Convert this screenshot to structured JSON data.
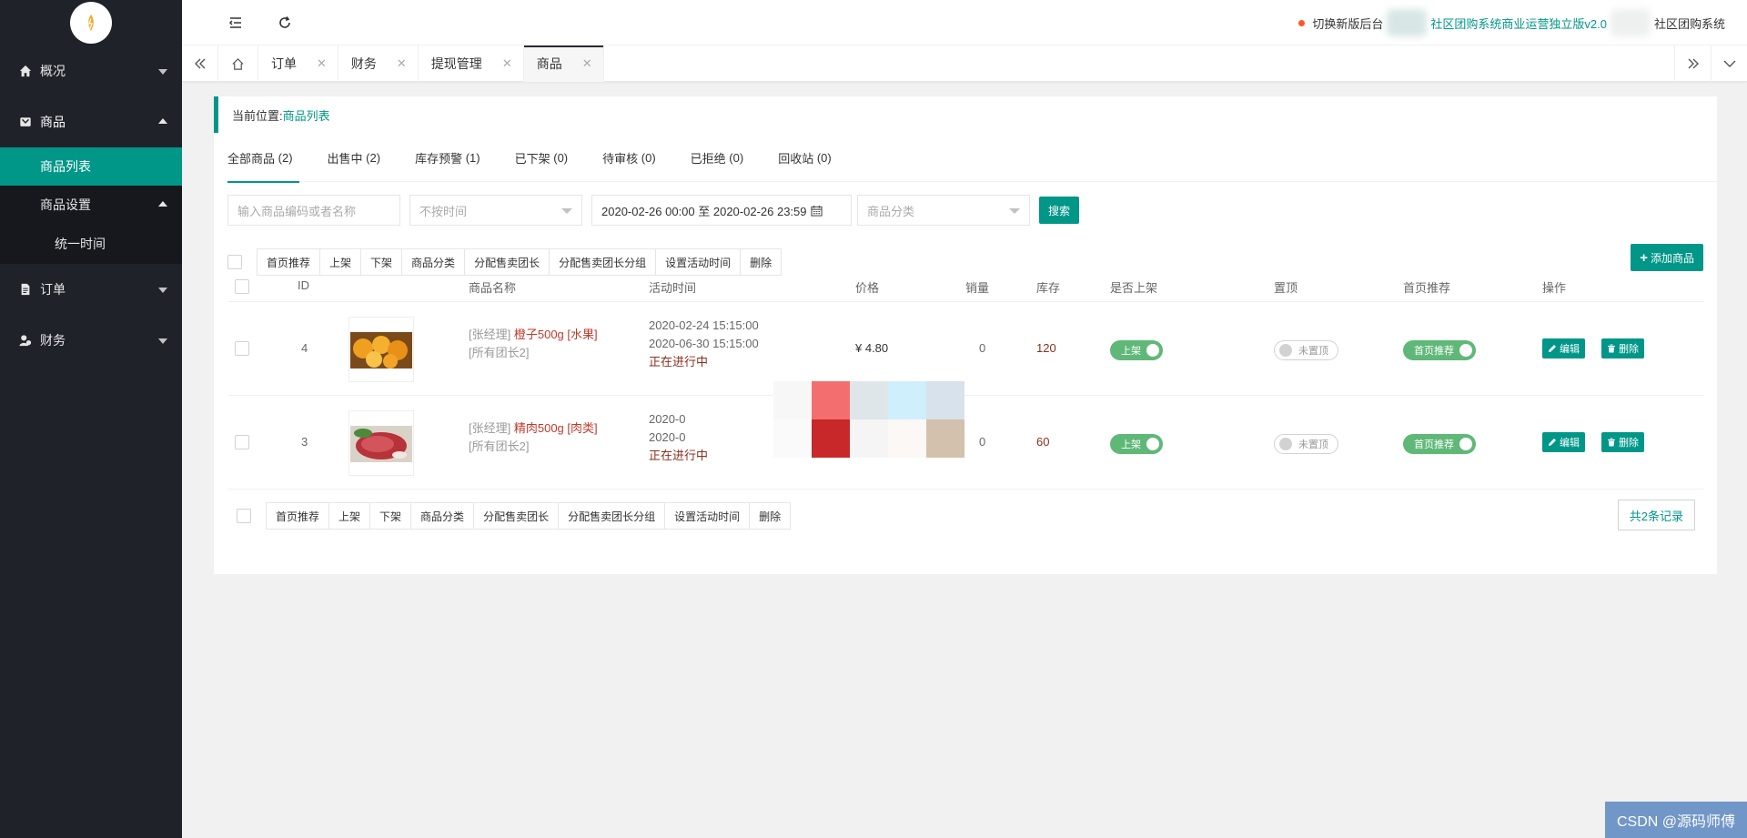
{
  "sidebar": {
    "groups": [
      {
        "label": "概况",
        "icon": "home-icon"
      },
      {
        "label": "商品",
        "icon": "goods-icon"
      },
      {
        "label": "订单",
        "icon": "order-icon"
      },
      {
        "label": "财务",
        "icon": "finance-icon"
      }
    ],
    "goods_sub": {
      "list": "商品列表",
      "settings": "商品设置",
      "unify_time": "统一时间"
    }
  },
  "header": {
    "switch_text": "切换新版后台",
    "system_link": "社区团购系统商业运营独立版v2.0",
    "system_name": "社区团购系统"
  },
  "tabs": [
    "订单",
    "财务",
    "提现管理",
    "商品"
  ],
  "breadcrumb": {
    "prefix": "当前位置:",
    "current": "商品列表"
  },
  "subtabs": [
    {
      "label": "全部商品",
      "count": "(2)"
    },
    {
      "label": "出售中",
      "count": "(2)"
    },
    {
      "label": "库存预警",
      "count": "(1)"
    },
    {
      "label": "已下架",
      "count": "(0)"
    },
    {
      "label": "待审核",
      "count": "(0)"
    },
    {
      "label": "已拒绝",
      "count": "(0)"
    },
    {
      "label": "回收站",
      "count": "(0)"
    }
  ],
  "filters": {
    "keyword_placeholder": "输入商品编码或者名称",
    "time_select": "不按时间",
    "date_range": "2020-02-26 00:00 至 2020-02-26 23:59",
    "category_placeholder": "商品分类",
    "search_label": "搜索"
  },
  "toolbar_top": [
    "首页推荐",
    "上架",
    "下架",
    "商品分类",
    "分配售卖团长",
    "分配售卖团长分组",
    "设置活动时间",
    "删除"
  ],
  "toolbar_bottom": [
    "首页推荐",
    "上架",
    "下架",
    "商品分类",
    "分配售卖团长",
    "分配售卖团长分组",
    "设置活动时间",
    "删除"
  ],
  "add_label": "添加商品",
  "columns": [
    "ID",
    "商品名称",
    "活动时间",
    "价格",
    "销量",
    "库存",
    "是否上架",
    "置顶",
    "首页推荐",
    "操作"
  ],
  "rows": [
    {
      "id": "4",
      "manager": "[张经理]",
      "product": "橙子500g [水果]",
      "scope": "[所有团长2]",
      "start": "2020-02-24 15:15:00",
      "end": "2020-06-30 15:15:00",
      "status": "正在进行中",
      "price": "¥ 4.80",
      "sales": "0",
      "stock": "120",
      "onsale": "上架",
      "top": "未置顶",
      "recommend": "首页推荐",
      "edit": "编辑",
      "delete": "删除"
    },
    {
      "id": "3",
      "manager": "[张经理]",
      "product": "精肉500g [肉类]",
      "scope": "[所有团长2]",
      "start": "2020-0",
      "end": "2020-0",
      "status": "正在进行中",
      "price": "",
      "sales": "0",
      "stock": "60",
      "onsale": "上架",
      "top": "未置顶",
      "recommend": "首页推荐",
      "edit": "编辑",
      "delete": "删除"
    }
  ],
  "total": "共2条记录",
  "watermark": "CSDN @源码师傅",
  "colors": {
    "accent": "#009688",
    "sidebar": "#20222a",
    "toggle_on": "#5fb878"
  }
}
